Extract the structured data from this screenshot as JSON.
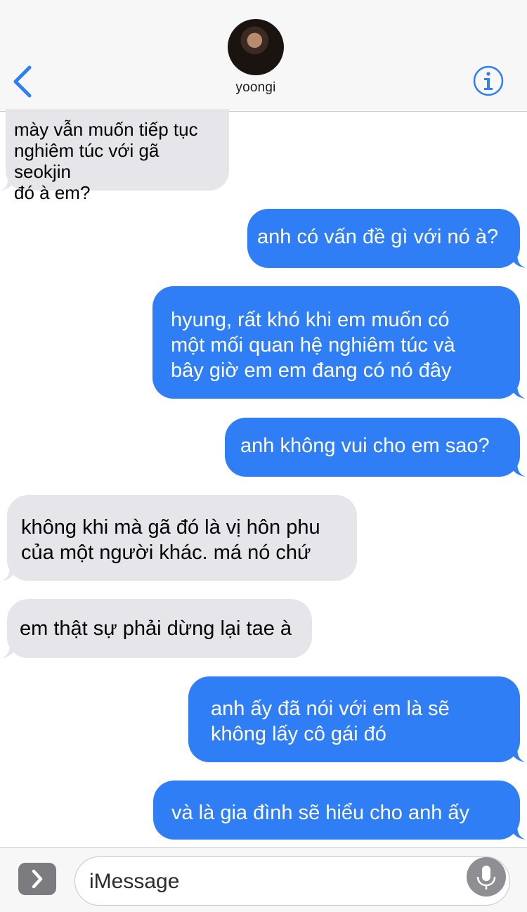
{
  "header": {
    "contact_name": "yoongi",
    "back_icon": "chevron-left-icon",
    "info_icon": "info-circle-icon",
    "accent_color": "#2f7ef6"
  },
  "messages": [
    {
      "direction": "incoming",
      "text": "mày vẫn muốn tiếp tục\nnghiêm túc với gã seokjin\nđó à em?"
    },
    {
      "direction": "outgoing",
      "text": "anh có vấn đề gì với nó à?"
    },
    {
      "direction": "outgoing",
      "text": "hyung, rất khó khi em muốn có\nmột mối quan hệ nghiêm túc và\nbây giờ em em đang có nó đây"
    },
    {
      "direction": "outgoing",
      "text": "anh không vui cho em sao?"
    },
    {
      "direction": "incoming",
      "text": "không khi mà gã đó là vị hôn phu\ncủa một người khác. má nó chứ"
    },
    {
      "direction": "incoming",
      "text": "em thật sự phải dừng lại tae à"
    },
    {
      "direction": "outgoing",
      "text": "anh ấy đã nói với em là sẽ\nkhông lấy cô gái đó"
    },
    {
      "direction": "outgoing",
      "text": "và là gia đình sẽ hiểu cho anh ấy"
    }
  ],
  "colors": {
    "incoming_bubble": "#e5e5ea",
    "outgoing_bubble": "#2f7ef6"
  },
  "composer": {
    "placeholder": "iMessage",
    "apps_icon": "chevron-right-icon",
    "mic_icon": "microphone-icon"
  }
}
